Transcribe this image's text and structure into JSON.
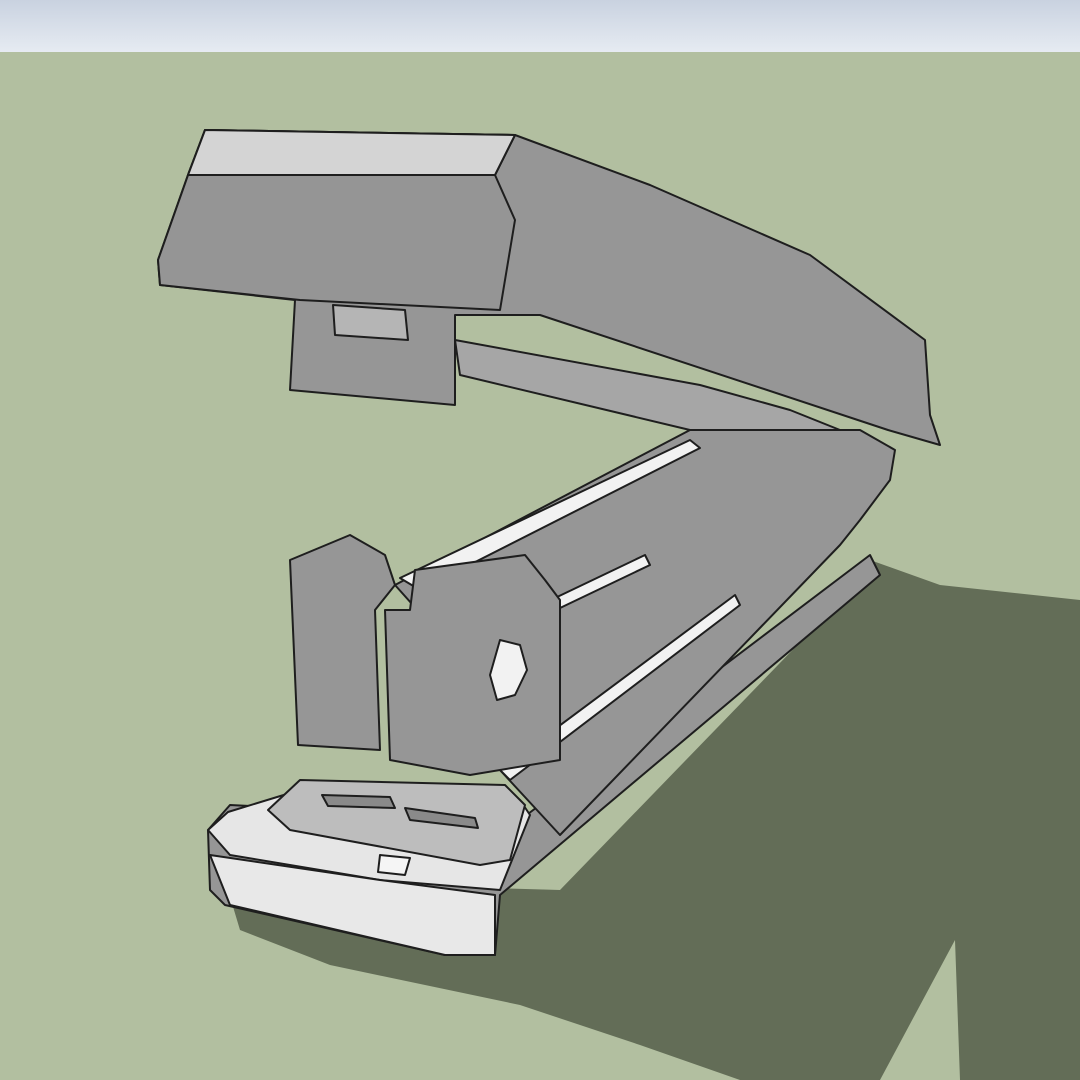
{
  "scene": {
    "sky_color": "#d9e0ea",
    "ground_color": "#b2bfa0",
    "shadow_color": "#636d57",
    "body_fill": "#969696",
    "body_light": "#e6e6e6",
    "edge_color": "#1e1e1e"
  },
  "model": {
    "subject": "stapler-model",
    "parts": [
      "top-cover",
      "magazine",
      "base",
      "anvil",
      "front-guide"
    ]
  }
}
